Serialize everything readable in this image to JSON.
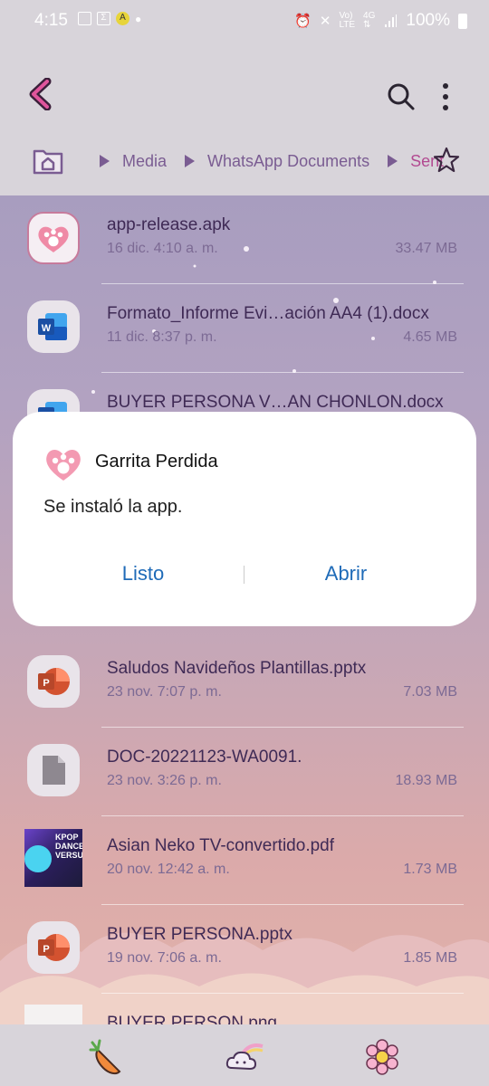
{
  "status": {
    "time": "4:15",
    "battery": "100%"
  },
  "breadcrumb": {
    "items": [
      "Media",
      "WhatsApp Documents"
    ],
    "current": "Sent"
  },
  "files": [
    {
      "name": "app-release.apk",
      "date": "16 dic. 4:10 a. m.",
      "size": "33.47 MB",
      "icon": "paw-app-icon"
    },
    {
      "name": "Formato_Informe Evi…ación AA4 (1).docx",
      "date": "11 dic. 8:37 p. m.",
      "size": "4.65 MB",
      "icon": "word-icon"
    },
    {
      "name": "BUYER PERSONA V…AN CHONLON.docx",
      "date": "",
      "size": "",
      "icon": "word-icon"
    },
    {
      "name": "Saludos Navideños Plantillas.pptx",
      "date": "23 nov. 7:07 p. m.",
      "size": "7.03 MB",
      "icon": "powerpoint-icon"
    },
    {
      "name": "DOC-20221123-WA0091.",
      "date": "23 nov. 3:26 p. m.",
      "size": "18.93 MB",
      "icon": "generic-file-icon"
    },
    {
      "name": "Asian Neko TV-convertido.pdf",
      "date": "20 nov. 12:42 a. m.",
      "size": "1.73 MB",
      "icon": "pdf-thumbnail"
    },
    {
      "name": "BUYER PERSONA.pptx",
      "date": "19 nov. 7:06 a. m.",
      "size": "1.85 MB",
      "icon": "powerpoint-icon"
    },
    {
      "name": "BUYER PERSON.png",
      "date": "",
      "size": "",
      "icon": "image-thumbnail"
    }
  ],
  "thumb_text": {
    "kpop": "KPOP",
    "dance": "DANCE",
    "versus": "VERSUS"
  },
  "dialog": {
    "app_name": "Garrita Perdida",
    "message": "Se instaló la app.",
    "btn_done": "Listo",
    "btn_open": "Abrir"
  },
  "colors": {
    "accent": "#b24a91",
    "dialog_button": "#1f6bb8",
    "breadcrumb": "#7a5c92"
  }
}
